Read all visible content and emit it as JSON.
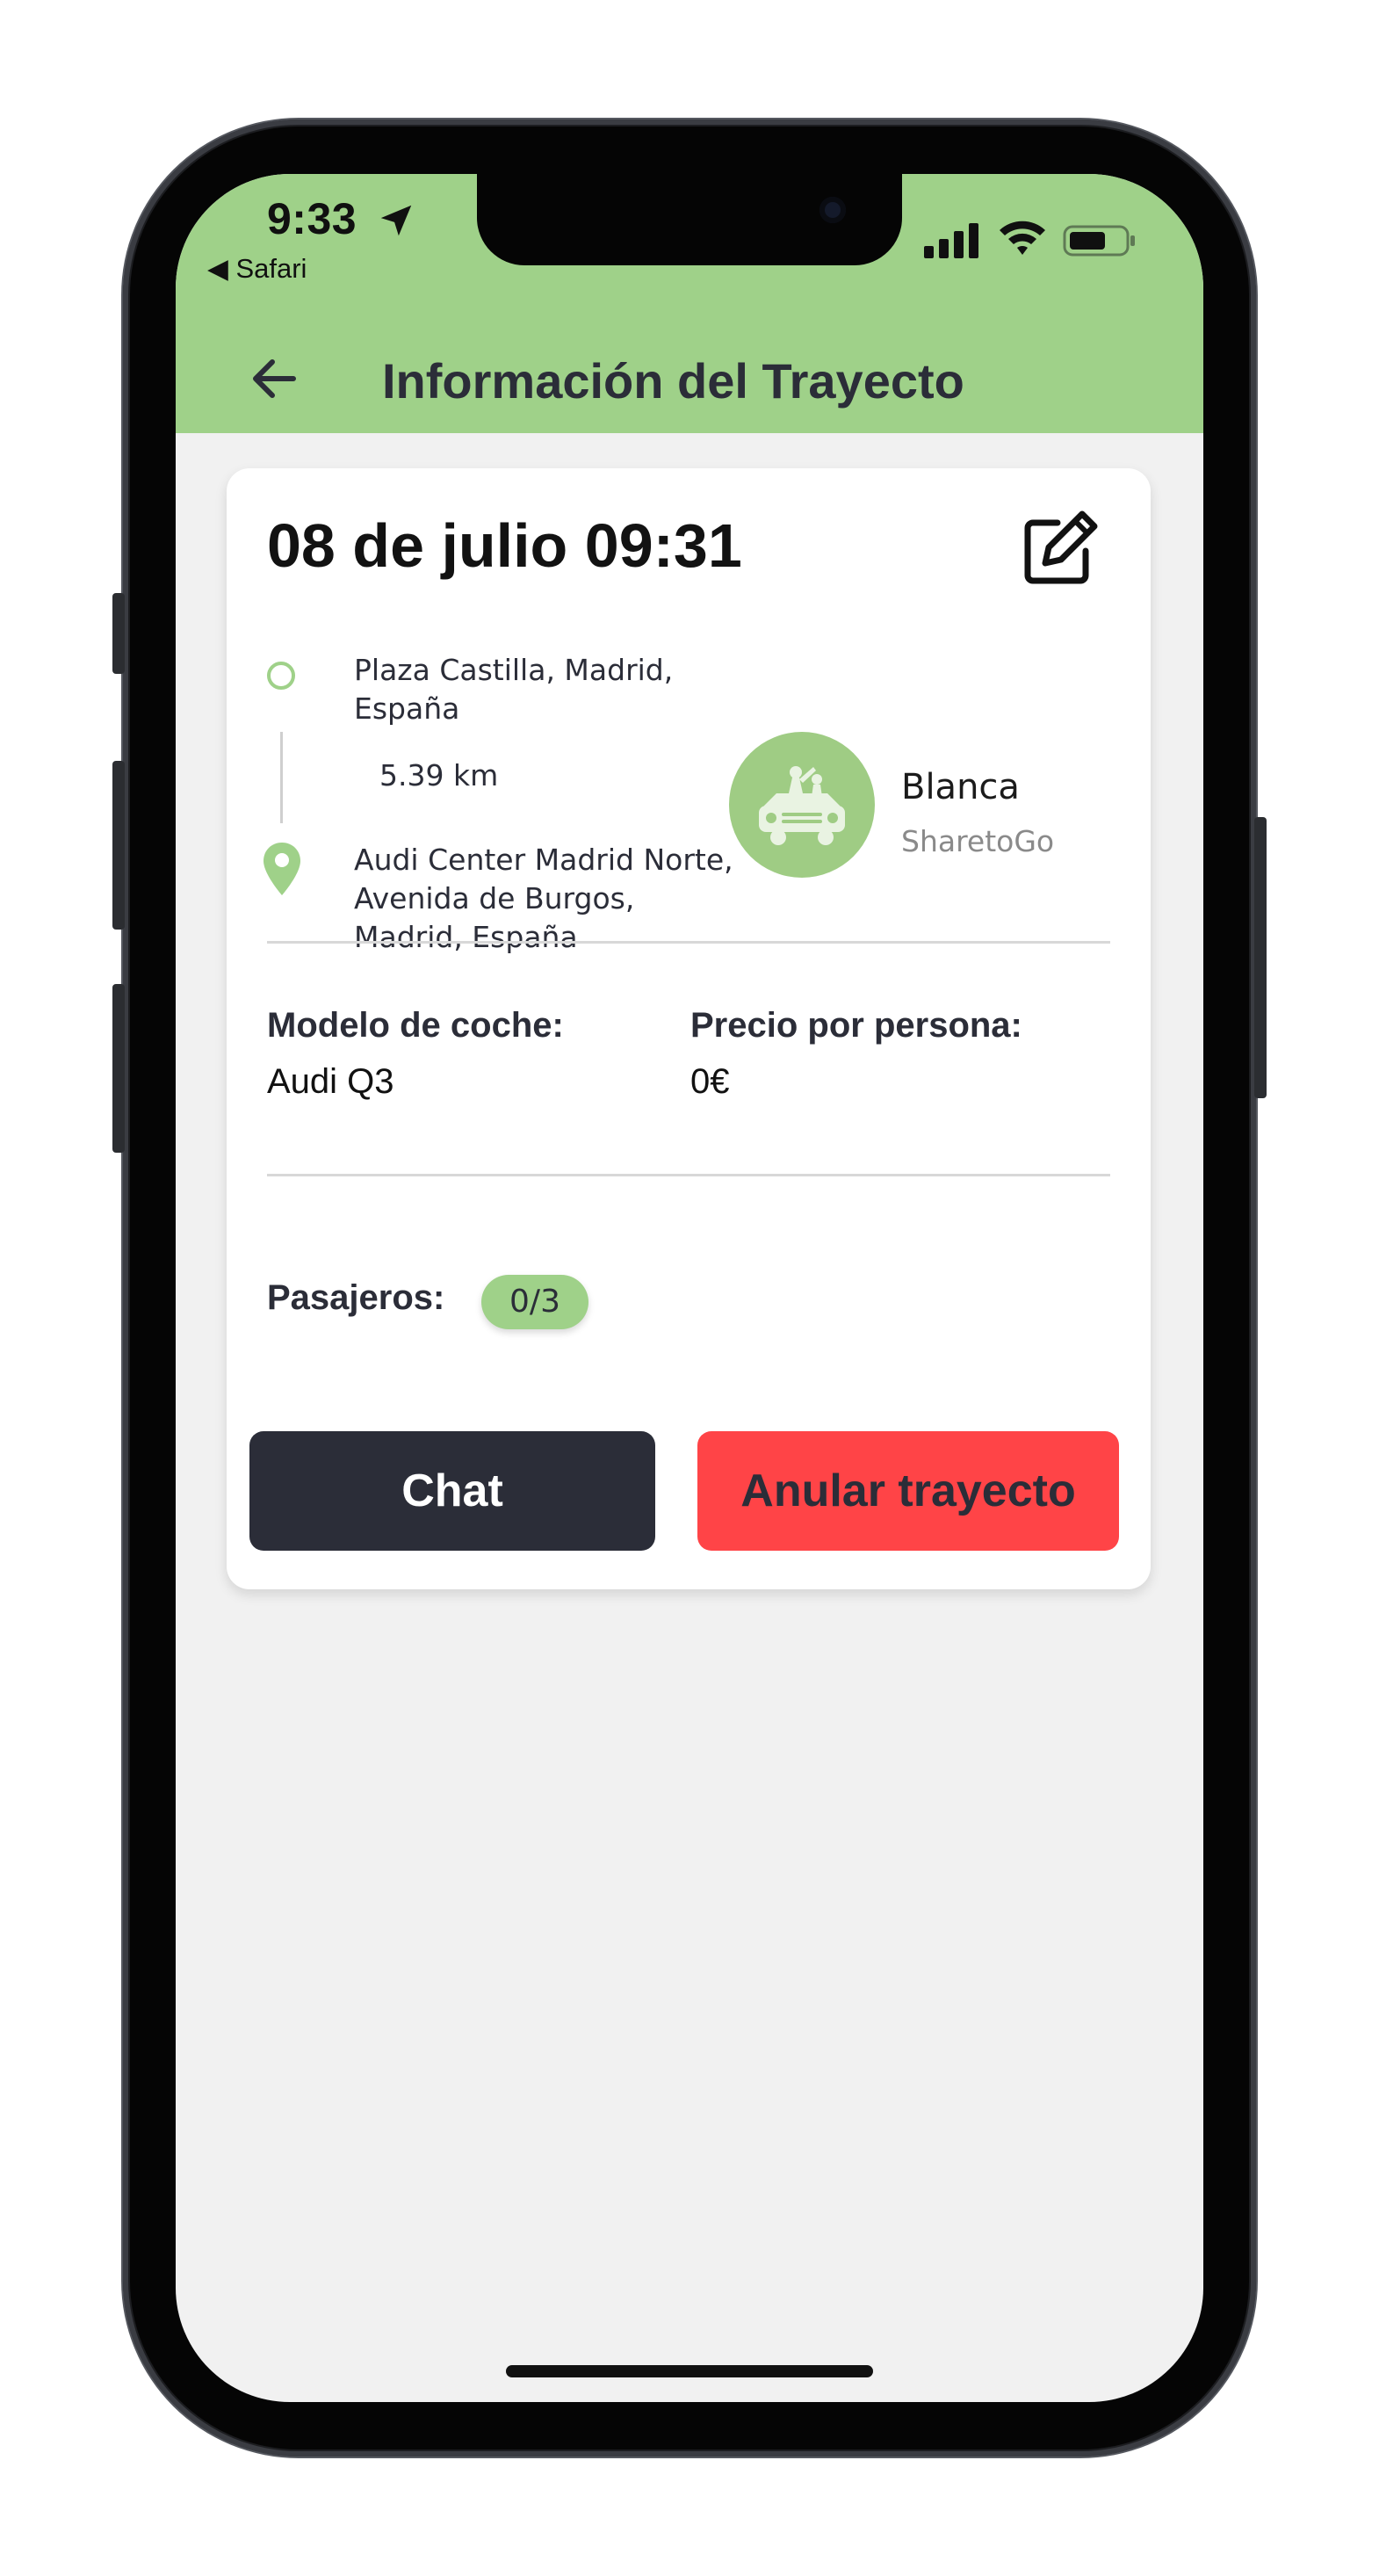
{
  "status_bar": {
    "time": "9:33",
    "back_app": "◀ Safari",
    "color": "#9fd189"
  },
  "header": {
    "title": "Información del Trayecto",
    "back_icon": "arrow-left-icon"
  },
  "trip": {
    "date": "08 de julio 09:31",
    "edit_icon": "edit-icon",
    "origin": "Plaza Castilla, Madrid, España",
    "distance": "5.39 km",
    "destination": "Audi Center Madrid Norte, Avenida de Burgos, Madrid, España",
    "driver": {
      "name": "Blanca",
      "company": "SharetoGo"
    },
    "car_model_label": "Modelo de coche:",
    "car_model": "Audi Q3",
    "price_label": "Precio por persona:",
    "price": "0€",
    "passengers_label": "Pasajeros:",
    "passengers": "0/3"
  },
  "actions": {
    "chat_label": "Chat",
    "cancel_label": "Anular trayecto",
    "chat_color": "#2b2d38",
    "cancel_color": "#ff4447"
  }
}
